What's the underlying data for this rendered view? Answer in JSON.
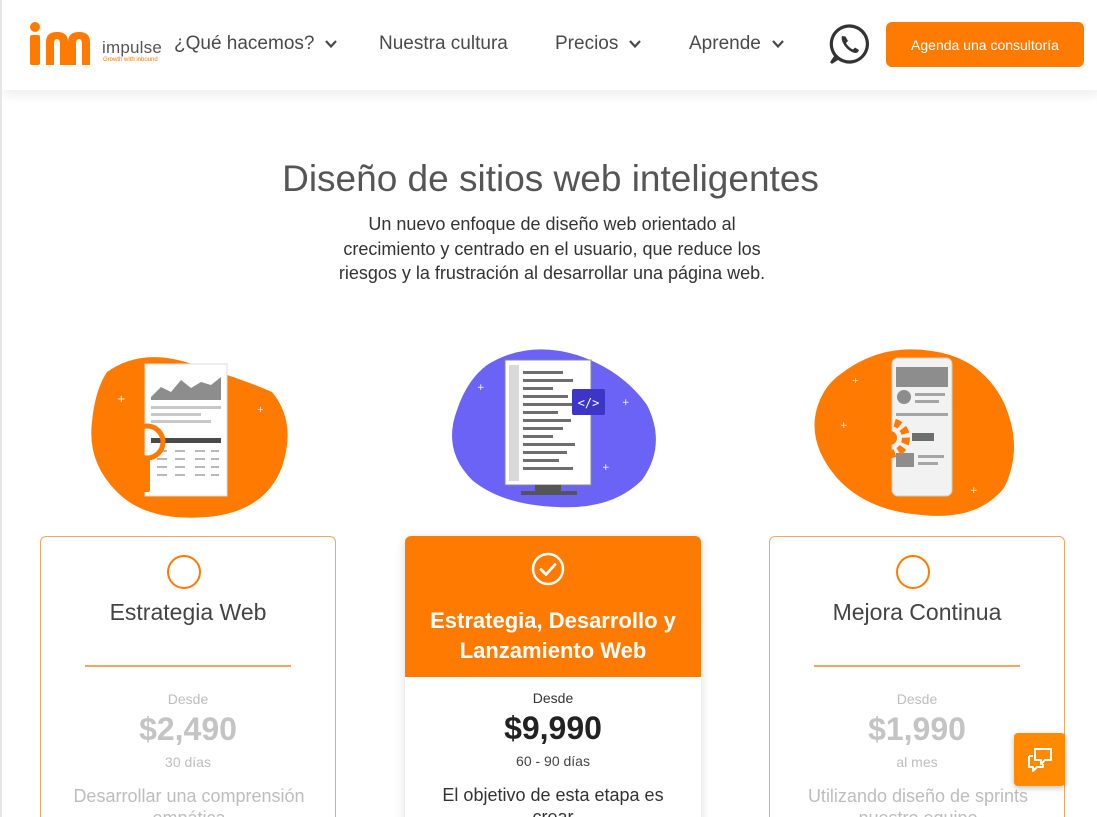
{
  "brand": {
    "name": "impulse",
    "tagline": "Growth with inbound",
    "accent_color": "#ff7a00"
  },
  "nav": {
    "items": [
      {
        "label": "¿Qué hacemos?",
        "has_dropdown": true
      },
      {
        "label": "Nuestra cultura",
        "has_dropdown": false
      },
      {
        "label": "Precios",
        "has_dropdown": true
      },
      {
        "label": "Aprende",
        "has_dropdown": true
      }
    ],
    "whatsapp_icon": "whatsapp-icon",
    "cta_label": "Agenda una consultoría"
  },
  "hero": {
    "title": "Diseño de sitios web inteligentes",
    "subtitle": "Un nuevo enfoque de diseño web orientado al crecimiento y centrado en el usuario, que reduce los riesgos y la frustración al desarrollar una página web."
  },
  "plans": [
    {
      "title": "Estrategia Web",
      "from_label": "Desde",
      "price": "$2,490",
      "period": "30 días",
      "description": "Desarrollar una comprensión empática",
      "selected": false
    },
    {
      "title": "Estrategia, Desarrollo y Lanzamiento Web",
      "from_label": "Desde",
      "price": "$9,990",
      "period": "60 - 90 días",
      "description": "El objetivo de esta etapa es crear",
      "selected": true
    },
    {
      "title": "Mejora Continua",
      "from_label": "Desde",
      "price": "$1,990",
      "period": "al mes",
      "description": "Utilizando diseño de sprints nuestro equipo",
      "selected": false
    }
  ],
  "chat": {
    "icon": "chat-bubbles-icon"
  }
}
